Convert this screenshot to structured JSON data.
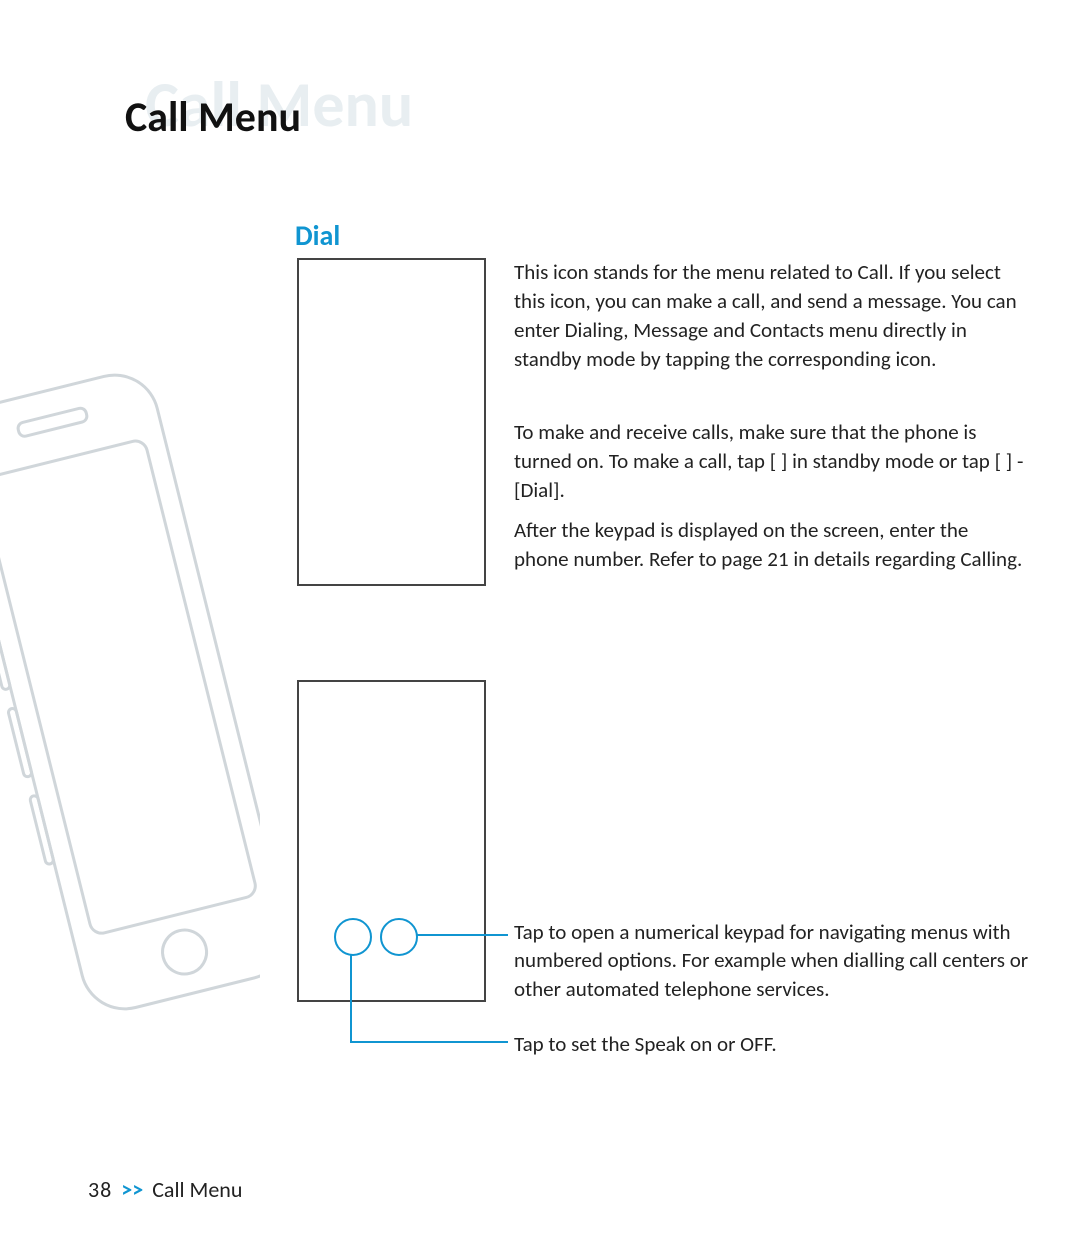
{
  "title_ghost": "Call Menu",
  "title": "Call Menu",
  "section": "Dial",
  "paragraphs": {
    "p1": "This icon stands for the menu related to Call. If you select this icon, you can make a call, and send a message. You can enter Dialing, Message and Contacts menu directly in standby mode by tapping the corresponding icon.",
    "p2": "To make and receive calls, make sure that the phone is turned on. To make a call, tap [       ] in standby mode or tap [      ] - [Dial].",
    "p3": "After the keypad is displayed on the screen, enter the phone number. Refer to page 21 in details regarding Calling."
  },
  "callouts": {
    "c1": "Tap        to open a numerical keypad for navigating menus with numbered options. For example when dialling call centers or other automated telephone services.",
    "c2": "Tap        to set the Speak on or OFF."
  },
  "footer": {
    "page_number": "38",
    "separator": ">>",
    "crumb": "Call Menu"
  }
}
